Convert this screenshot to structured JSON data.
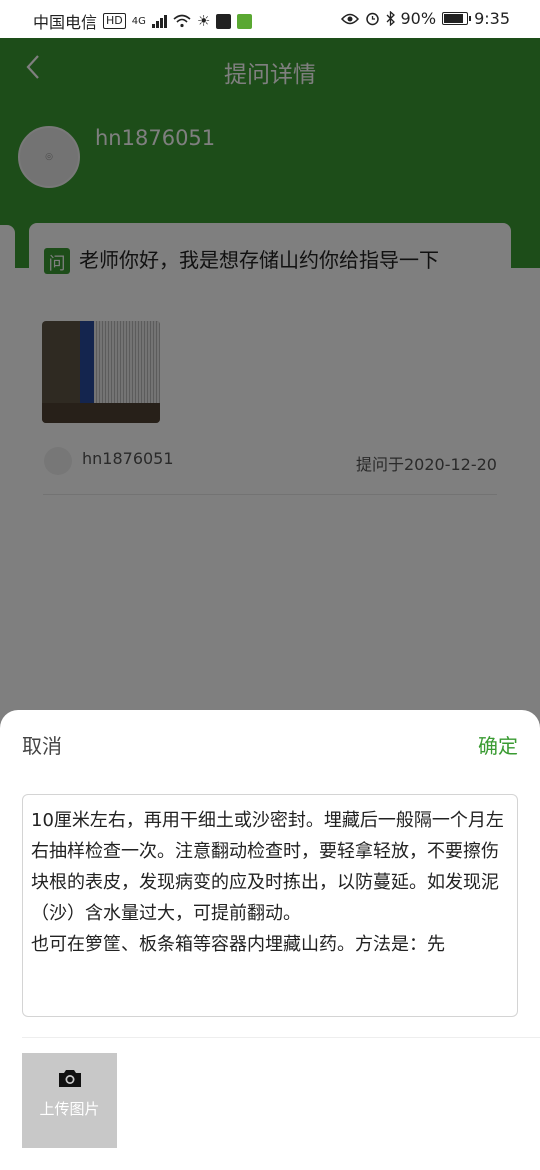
{
  "status_bar": {
    "carrier": "中国电信",
    "hd_badge": "HD",
    "network": "4G",
    "battery": "90%",
    "time": "9:35"
  },
  "header": {
    "title": "提问详情",
    "username": "hn1876051"
  },
  "question": {
    "badge": "问",
    "text": "老师你好，我是想存储山约你给指导一下",
    "author": "hn1876051",
    "date": "提问于2020-12-20"
  },
  "sheet": {
    "cancel_label": "取消",
    "confirm_label": "确定",
    "answer_text": "10厘米左右，再用干细土或沙密封。埋藏后一般隔一个月左右抽样检查一次。注意翻动检查时，要轻拿轻放，不要擦伤块根的表皮，发现病变的应及时拣出，以防蔓延。如发现泥 （沙）含水量过大，可提前翻动。\n也可在箩筐、板条箱等容器内埋藏山药。方法是：先",
    "upload_label": "上传图片"
  },
  "colors": {
    "brand_green": "#3a9b32",
    "overlay": "rgba(0,0,0,0.5)"
  }
}
